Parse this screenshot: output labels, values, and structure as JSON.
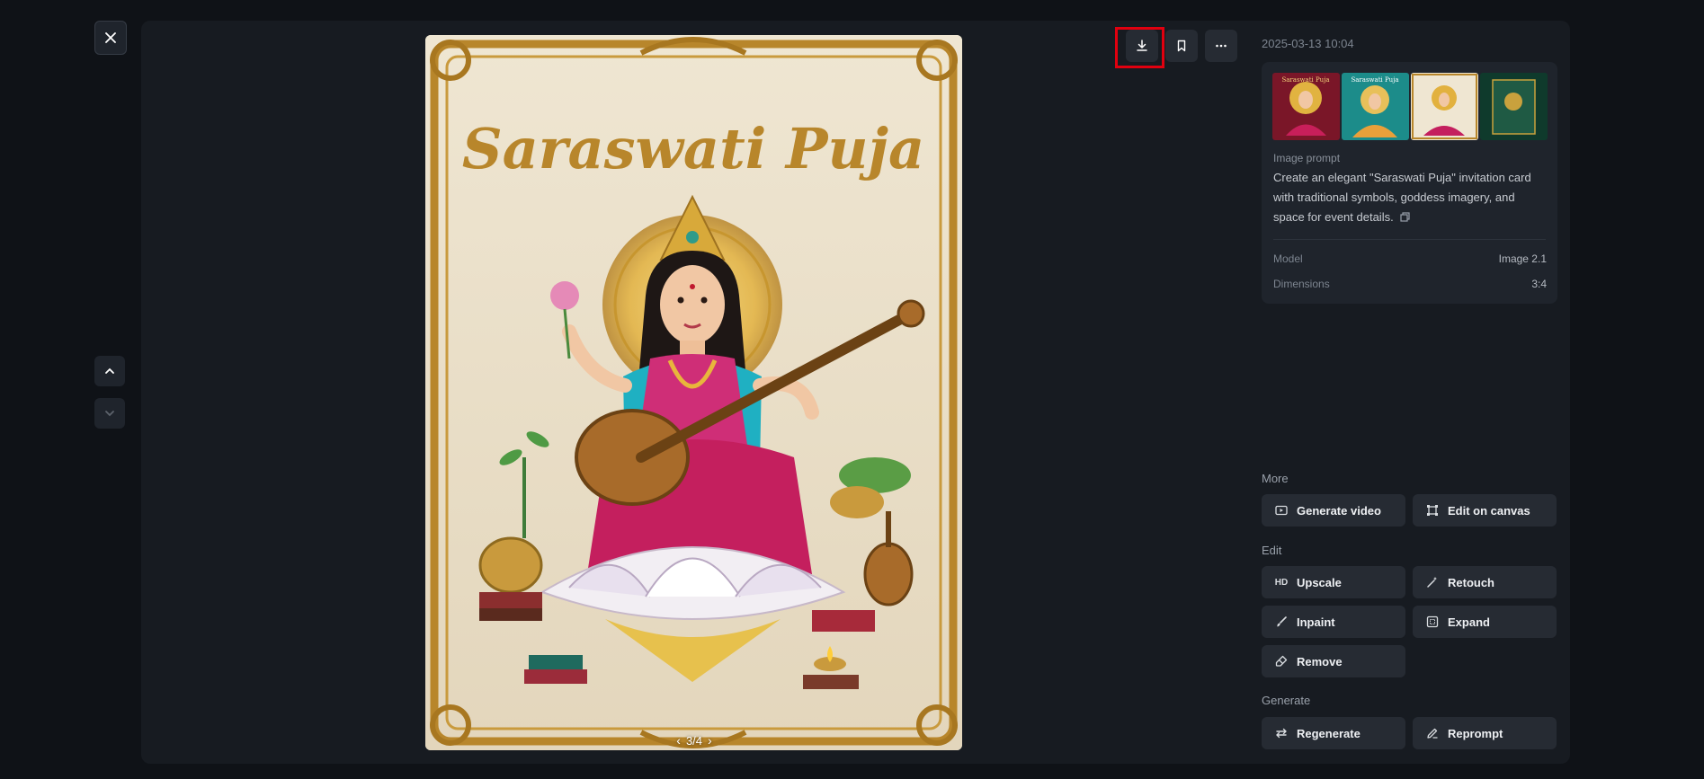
{
  "image": {
    "title_text": "Saraswati Puja",
    "pager": {
      "current": "3/4"
    }
  },
  "sidebar": {
    "timestamp": "2025-03-13 10:04",
    "prompt_label": "Image prompt",
    "prompt_text": "Create an elegant \"Saraswati Puja\" invitation card with traditional symbols, goddess imagery, and space for event details.",
    "model_key": "Model",
    "model_value": "Image 2.1",
    "dimensions_key": "Dimensions",
    "dimensions_value": "3:4",
    "thumb_labels": [
      "Saraswati Puja",
      "Saraswati Puja",
      "",
      ""
    ]
  },
  "sections": {
    "more": "More",
    "edit": "Edit",
    "generate": "Generate"
  },
  "actions": {
    "generate_video": "Generate video",
    "edit_on_canvas": "Edit on canvas",
    "upscale": "Upscale",
    "upscale_icon": "HD",
    "retouch": "Retouch",
    "inpaint": "Inpaint",
    "expand": "Expand",
    "remove": "Remove",
    "regenerate": "Regenerate",
    "reprompt": "Reprompt"
  },
  "colors": {
    "highlight": "#e1000f",
    "panel": "#171b21",
    "card": "#1f242c",
    "button": "#262b33",
    "gold": "#b8862b"
  }
}
